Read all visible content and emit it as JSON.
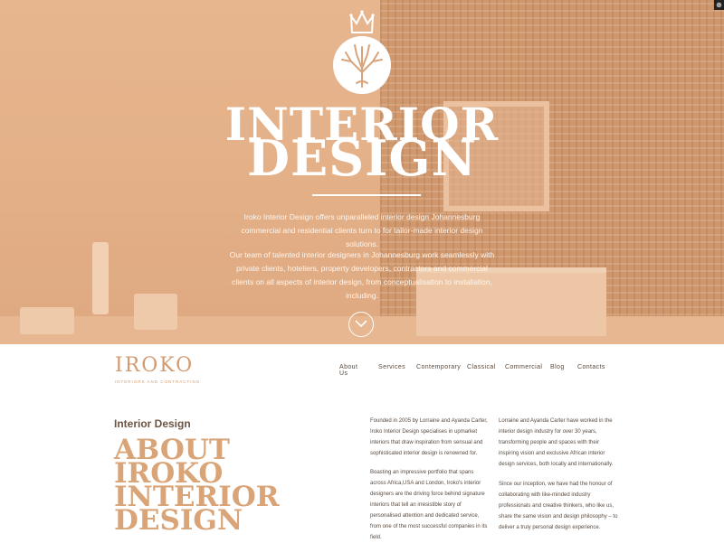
{
  "hero": {
    "title_line1": "INTERIOR",
    "title_line2": "DESIGN",
    "paragraph1": "Iroko Interior Design offers unparalleled interior design Johannesburg commercial and residential clients turn to for tailor-made interior design solutions.",
    "paragraph2": "Our team of talented interior designers in Johannesburg work seamlessly with private clients, hoteliers, property developers, contractors and commercial clients on all aspects of interior design, from conceptualisation to installation, including.",
    "scroll_icon": "chevron-down-icon",
    "emblem_icon": "tree-icon",
    "crown_icon": "crown-icon"
  },
  "header": {
    "logo_text": "IROKO",
    "logo_sub": "INTERIORS AND CONTRACTING",
    "nav": [
      "About Us",
      "Services",
      "Contemporary",
      "Classical",
      "Commercial",
      "Blog",
      "Contacts"
    ]
  },
  "about": {
    "subtitle": "Interior Design",
    "title_lines": [
      "ABOUT",
      "IROKO",
      "INTERIOR",
      "DESIGN"
    ],
    "col1_p1": "Founded in 2005 by Lorraine and Ayanda Carter, Iroko Interior Design specialises in upmarket interiors that draw inspiration from sensual and sophisticated interior design is renowned for.",
    "col1_p2": "Boasting an impressive portfolio that spans across Africa,USA and London, Iroko's interior designers are the driving force behind signature interiors that tell an irresistible story of personalised attention and dedicated service, from one of the most successful companies in its field.",
    "col2_p1": "Lorraine and Ayanda Carter have worked in the interior design industry for over 30 years, transforming people and spaces with their inspiring vision and exclusive African interior design services, both locally and internationally.",
    "col2_p2": "Since our inception, we have had the honour of collaborating with like-minded industry professionals and creative thinkers, who like us, share the same vision and design philosophy – to deliver a truly personal design experience."
  },
  "colors": {
    "accent": "#d9a477",
    "text_dark": "#5a4a3e",
    "hero_tint": "#e2b08d"
  }
}
